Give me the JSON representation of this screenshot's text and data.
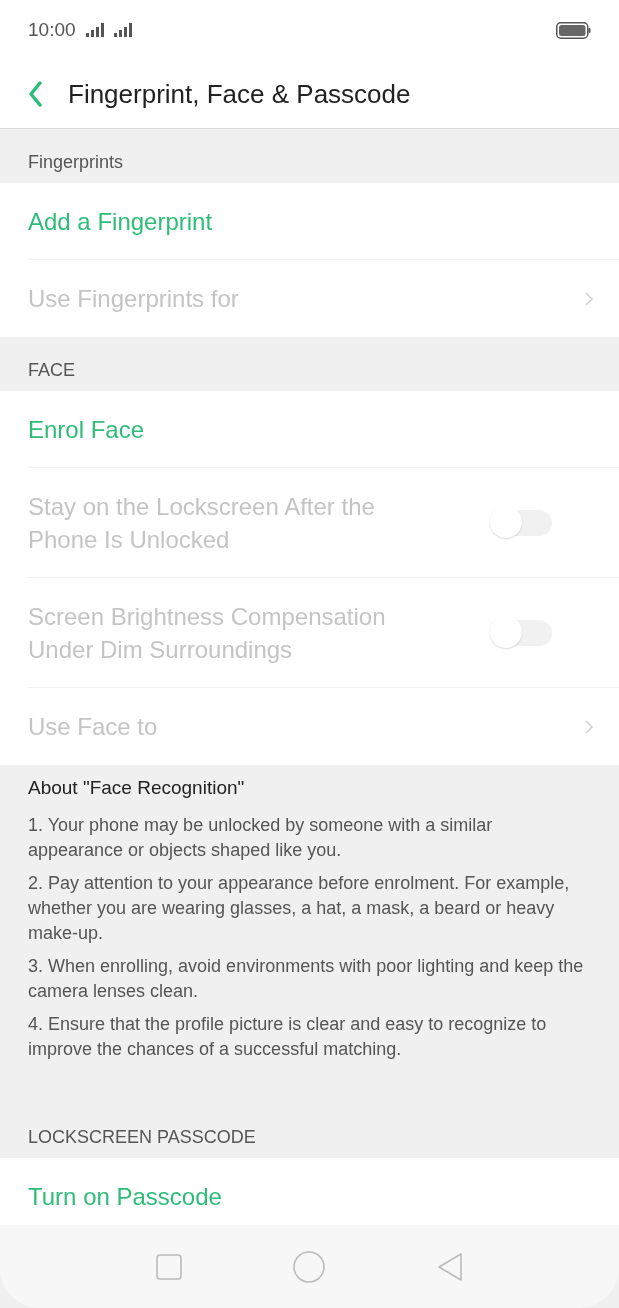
{
  "status_bar": {
    "time": "10:00"
  },
  "header": {
    "title": "Fingerprint, Face & Passcode"
  },
  "sections": [
    {
      "title": "Fingerprints",
      "items": [
        {
          "label": "Add a Fingerprint",
          "kind": "action",
          "disabled": false
        },
        {
          "label": "Use Fingerprints for",
          "kind": "link",
          "disabled": true
        }
      ]
    },
    {
      "title": "FACE",
      "items": [
        {
          "label": "Enrol Face",
          "kind": "action",
          "disabled": false
        },
        {
          "label": "Stay on the Lockscreen After the Phone Is Unlocked",
          "kind": "toggle",
          "disabled": true,
          "on": false
        },
        {
          "label": "Screen Brightness Compensation Under Dim Surroundings",
          "kind": "toggle",
          "disabled": true,
          "on": false
        },
        {
          "label": "Use Face to",
          "kind": "link",
          "disabled": true
        }
      ]
    },
    {
      "kind": "notes",
      "title": "About \"Face Recognition\"",
      "notes": [
        "1. Your phone may be unlocked by someone with a similar appearance or objects shaped like you.",
        "2. Pay attention to your appearance before enrolment. For example, whether you are wearing glasses, a hat, a mask, a beard or heavy make-up.",
        "3. When enrolling, avoid environments with poor lighting and keep the camera lenses clean.",
        "4. Ensure that the profile picture is clear and easy to recognize to improve the chances of a successful matching."
      ]
    },
    {
      "title": "LOCKSCREEN PASSCODE",
      "items": [
        {
          "label": "Turn on Passcode",
          "kind": "action",
          "disabled": false
        }
      ]
    }
  ]
}
